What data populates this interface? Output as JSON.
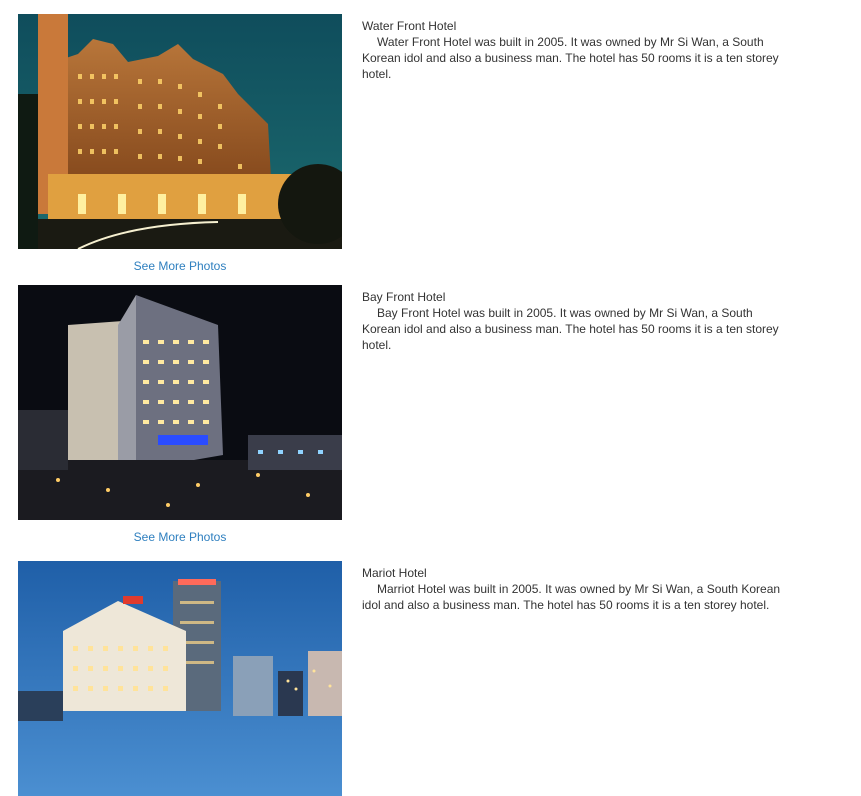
{
  "link_label": "See More Photos",
  "hotels": [
    {
      "name": "Water Front Hotel",
      "description": "Water Front  Hotel was built in 2005. It was owned by Mr Si Wan, a South Korean idol and also a business man. The hotel has 50 rooms it is a ten storey hotel."
    },
    {
      "name": "Bay Front Hotel",
      "description": "Bay Front  Hotel was built in 2005. It was owned by Mr Si Wan, a South Korean idol and also a business man. The hotel has 50 rooms it is a ten storey hotel."
    },
    {
      "name": "Mariot Hotel",
      "description": "Marriot  Hotel was built in 2005. It was owned by Mr Si Wan, a South Korean idol and also a business man. The hotel has 50 rooms it is a ten storey hotel."
    }
  ]
}
